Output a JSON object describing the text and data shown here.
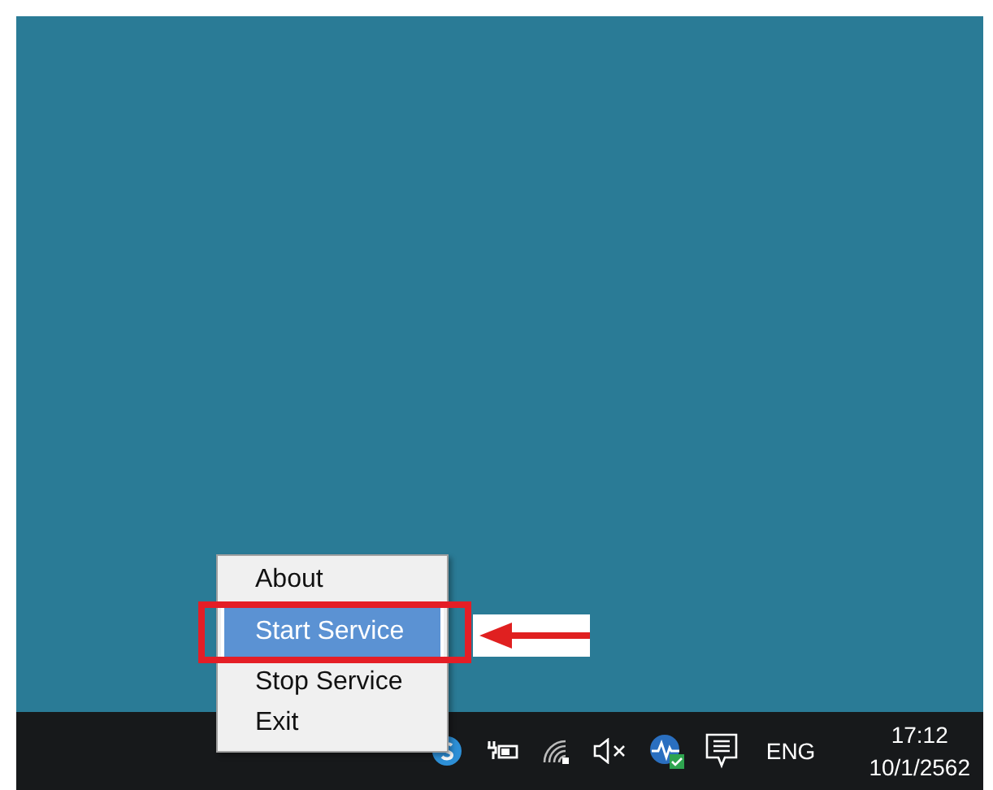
{
  "context_menu": {
    "items": [
      {
        "label": "About",
        "selected": false
      },
      {
        "label": "Start Service",
        "selected": true
      },
      {
        "label": "Stop Service",
        "selected": false
      },
      {
        "label": "Exit",
        "selected": false
      }
    ]
  },
  "taskbar": {
    "language": "ENG",
    "time": "17:12",
    "date": "10/1/2562"
  }
}
